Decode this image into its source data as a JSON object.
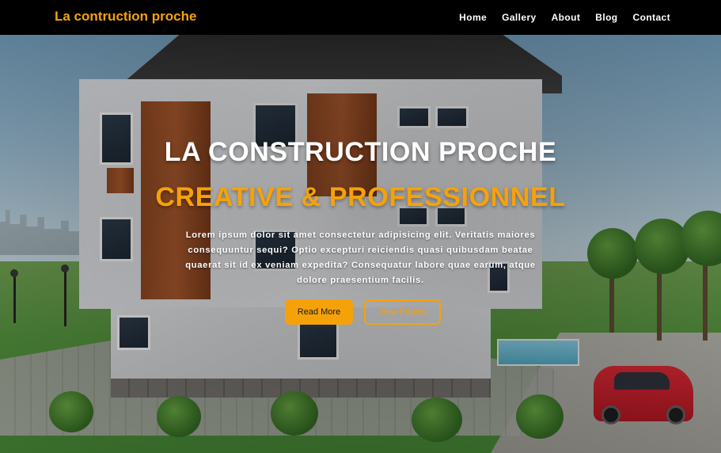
{
  "navbar": {
    "brand": "La contruction proche",
    "links": [
      "Home",
      "Gallery",
      "About",
      "Blog",
      "Contact"
    ]
  },
  "hero": {
    "title": "LA CONSTRUCTION PROCHE",
    "subtitle": "CREATIVE & PROFESSIONNEL",
    "description": "Lorem ipsum dolor sit amet consectetur adipisicing elit. Veritatis maiores consequuntur sequi? Optio excepturi reiciendis quasi quibusdam beatae quaerat sit id ex veniam expedita? Consequatur labore quae earum, atque dolore praesentium facilis.",
    "primary_button": "Read More",
    "secondary_button": "View Projets"
  },
  "colors": {
    "accent": "#f5a20a",
    "navbar_bg": "#000000",
    "text": "#ffffff"
  }
}
